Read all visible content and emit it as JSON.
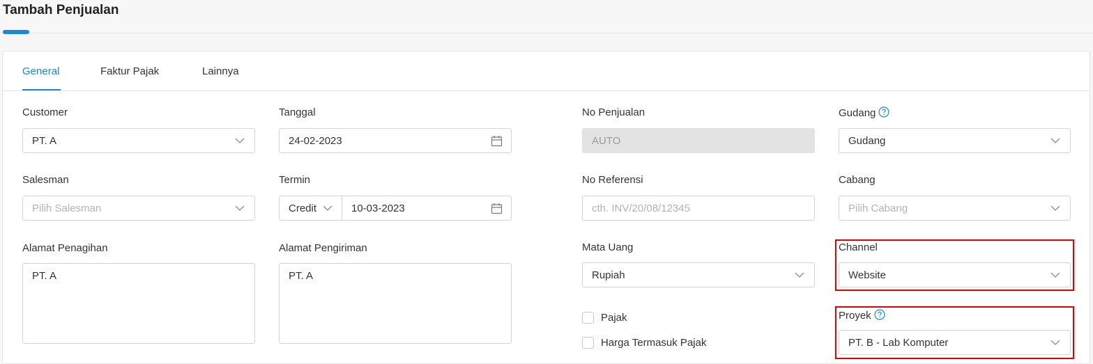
{
  "page": {
    "title": "Tambah Penjualan"
  },
  "tabs": [
    {
      "label": "General"
    },
    {
      "label": "Faktur Pajak"
    },
    {
      "label": "Lainnya"
    }
  ],
  "form": {
    "customer": {
      "label": "Customer",
      "value": "PT. A"
    },
    "tanggal": {
      "label": "Tanggal",
      "value": "24-02-2023"
    },
    "no_penjualan": {
      "label": "No Penjualan",
      "value": "AUTO"
    },
    "gudang": {
      "label": "Gudang",
      "value": "Gudang"
    },
    "salesman": {
      "label": "Salesman",
      "placeholder": "Pilih Salesman"
    },
    "termin": {
      "label": "Termin",
      "type": "Credit",
      "date": "10-03-2023"
    },
    "no_referensi": {
      "label": "No Referensi",
      "placeholder": "cth. INV/20/08/12345"
    },
    "cabang": {
      "label": "Cabang",
      "placeholder": "Pilih Cabang"
    },
    "alamat_penagihan": {
      "label": "Alamat Penagihan",
      "value": "PT. A"
    },
    "alamat_pengiriman": {
      "label": "Alamat Pengiriman",
      "value": "PT. A"
    },
    "mata_uang": {
      "label": "Mata Uang",
      "value": "Rupiah"
    },
    "channel": {
      "label": "Channel",
      "value": "Website"
    },
    "pajak": {
      "label": "Pajak",
      "checked": false
    },
    "harga_termasuk_pajak": {
      "label": "Harga Termasuk Pajak",
      "checked": false
    },
    "proyek": {
      "label": "Proyek",
      "value": "PT. B - Lab Komputer"
    }
  },
  "colors": {
    "accent": "#1a87d8",
    "highlight": "#e00000",
    "disabled_bg": "#e3e3e3"
  },
  "icons": {
    "select": "chevron-down-icon",
    "date": "calendar-icon",
    "help": "help-circle-icon"
  }
}
